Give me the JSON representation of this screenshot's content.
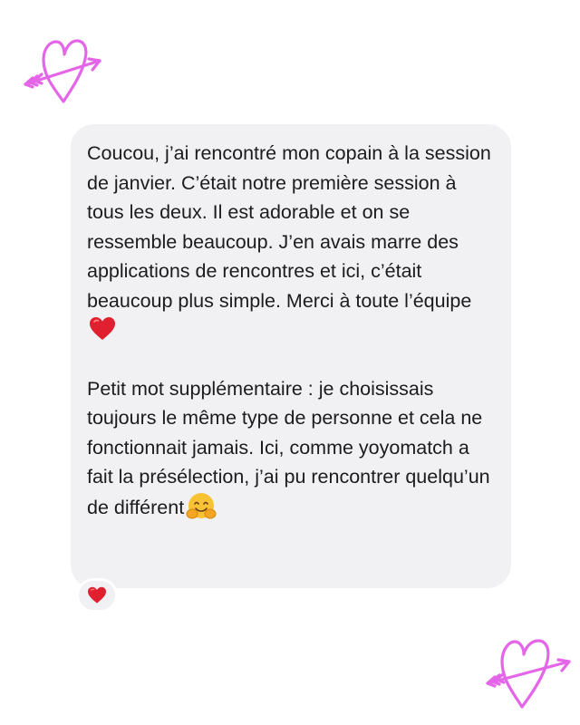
{
  "message": {
    "paragraph_1": "Coucou, j’ai rencontré mon copain à la session de janvier. C’était notre première session à tous les deux. Il est adorable et on se ressemble beaucoup. J’en avais marre des applications de rencontres et ici, c’était beaucoup plus simple. Merci à toute l’équipe",
    "paragraph_1_emoji": "red-heart-icon",
    "paragraph_2": "Petit mot supplémentaire : je choisissais toujours le même type de personne et cela ne fonctionnait jamais. Ici, comme yoyomatch a fait la présélection, j’ai pu rencontrer quelqu’un de différent",
    "paragraph_2_emoji": "hugging-face-icon"
  },
  "reaction": {
    "icon": "red-heart-icon"
  },
  "decorations": [
    {
      "icon": "heart-arrow-icon",
      "color": "#e465e8"
    },
    {
      "icon": "heart-arrow-icon",
      "color": "#e465e8"
    }
  ],
  "colors": {
    "bubble_background": "#f1f1f3",
    "text": "#1c1c1e",
    "decoration": "#e465e8",
    "heart_emoji": "#e0202e"
  }
}
